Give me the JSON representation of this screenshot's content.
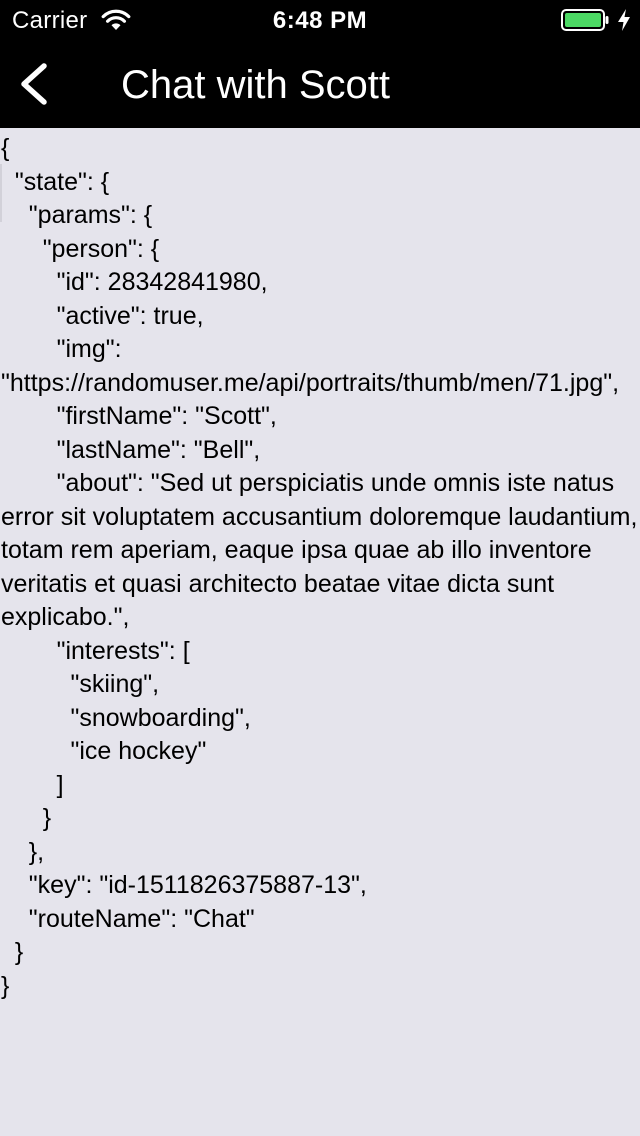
{
  "status_bar": {
    "carrier": "Carrier",
    "time": "6:48 PM",
    "battery_level": 1.0,
    "battery_color": "#4cd964",
    "wifi_icon": "wifi-icon",
    "charging_icon": "lightning-bolt-icon"
  },
  "nav_bar": {
    "back_icon": "chevron-left-icon",
    "title": "Chat with Scott",
    "background": "#000000"
  },
  "content": {
    "background": "#e5e4ec",
    "json_text": "{\n  \"state\": {\n    \"params\": {\n      \"person\": {\n        \"id\": 28342841980,\n        \"active\": true,\n        \"img\": \"https://randomuser.me/api/portraits/thumb/men/71.jpg\",\n        \"firstName\": \"Scott\",\n        \"lastName\": \"Bell\",\n        \"about\": \"Sed ut perspiciatis unde omnis iste natus error sit voluptatem accusantium doloremque laudantium, totam rem aperiam, eaque ipsa quae ab illo inventore veritatis et quasi architecto beatae vitae dicta sunt explicabo.\",\n        \"interests\": [\n          \"skiing\",\n          \"snowboarding\",\n          \"ice hockey\"\n        ]\n      }\n    },\n    \"key\": \"id-1511826375887-13\",\n    \"routeName\": \"Chat\"\n  }\n}"
  }
}
